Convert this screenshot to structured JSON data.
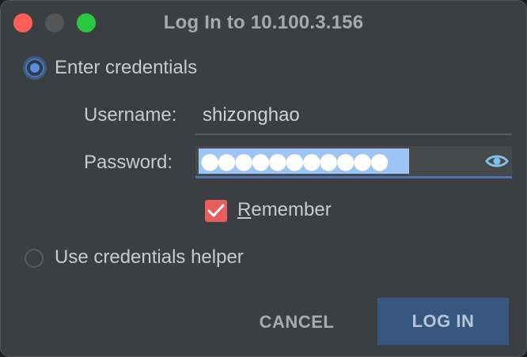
{
  "window": {
    "title": "Log In to 10.100.3.156"
  },
  "auth_options": {
    "enter_credentials_label": "Enter credentials",
    "enter_credentials_selected": true,
    "credentials_helper_label": "Use credentials helper",
    "credentials_helper_selected": false
  },
  "form": {
    "username_label": "Username:",
    "username_value": "shizonghao",
    "password_label": "Password:",
    "password_masked": "●●●●●●●●●●●",
    "remember_mnemonic": "R",
    "remember_rest": "emember",
    "remember_checked": true
  },
  "buttons": {
    "cancel_label": "CANCEL",
    "login_label": "LOG IN"
  },
  "icons": {
    "reveal_password": "eye-icon",
    "check": "checkmark-icon"
  },
  "colors": {
    "accent": "#4c76b3",
    "checkbox": "#e85c5c",
    "login_button": "#365880",
    "selection": "#9ec4f5"
  }
}
